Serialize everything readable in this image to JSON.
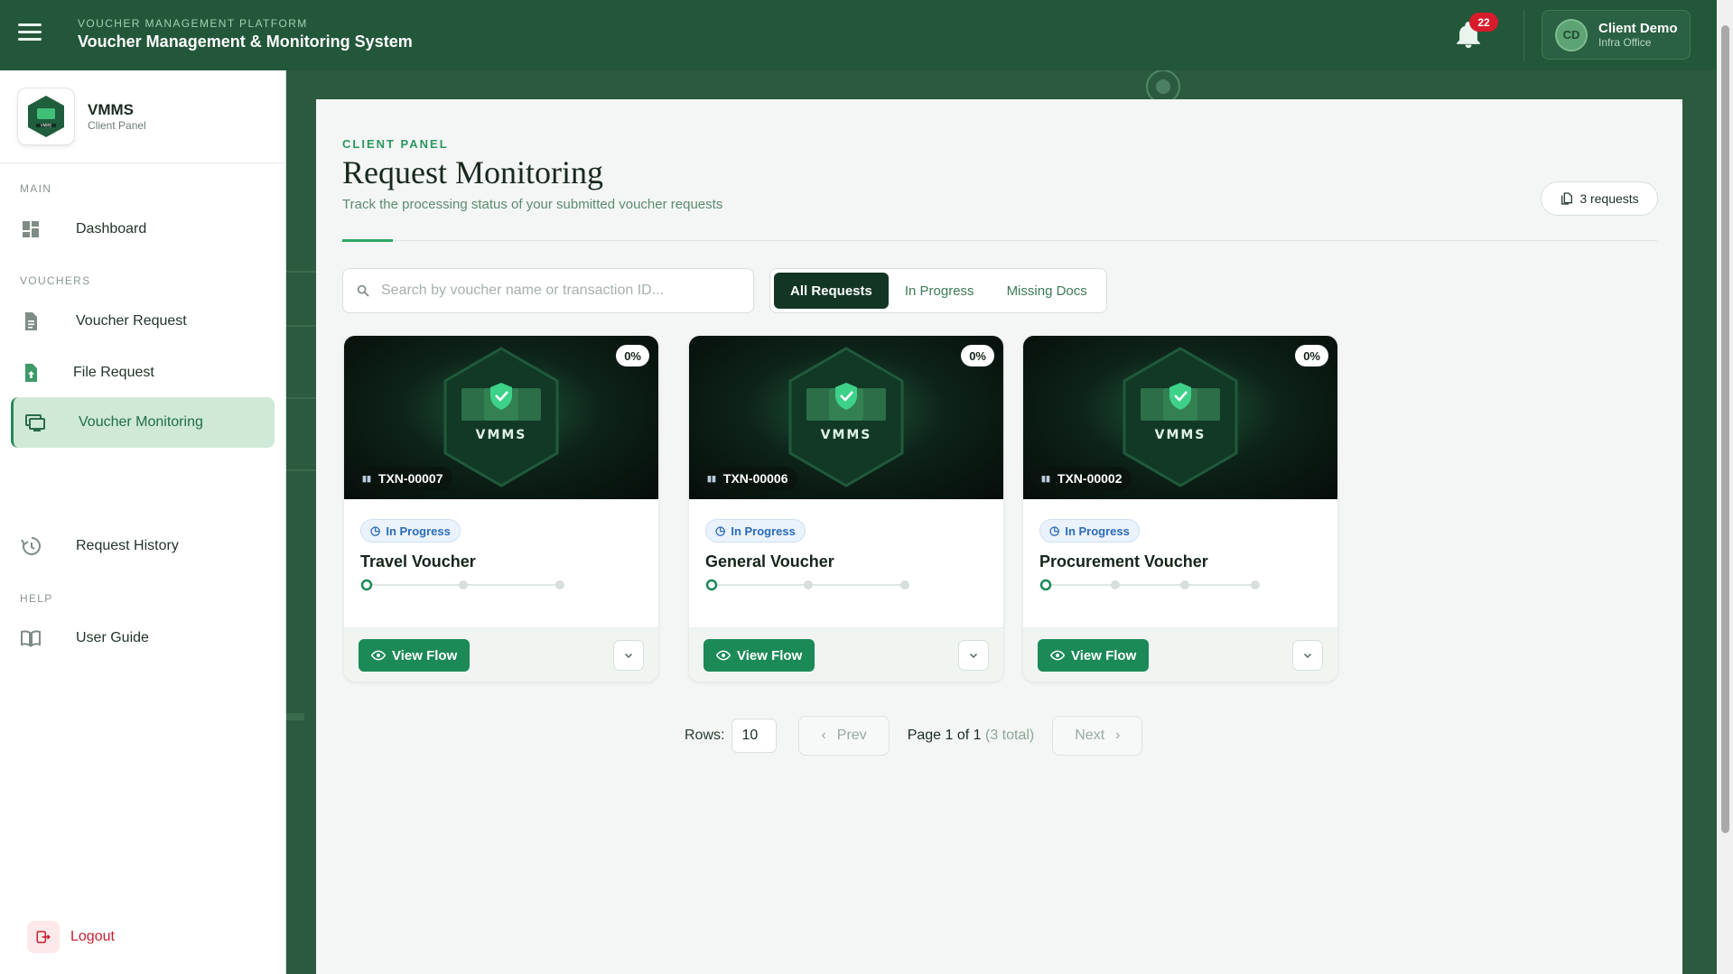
{
  "header": {
    "platform_label": "VOUCHER MANAGEMENT PLATFORM",
    "title": "Voucher Management & Monitoring System",
    "notification_count": "22",
    "user": {
      "initials": "CD",
      "name": "Client Demo",
      "org": "Infra Office"
    }
  },
  "sidebar": {
    "brand_name": "VMMS",
    "brand_sub": "Client Panel",
    "logo_text": "VMMS",
    "sections": {
      "main": "MAIN",
      "vouchers": "VOUCHERS",
      "help": "HELP"
    },
    "items": [
      {
        "label": "Dashboard",
        "icon": "dashboard-icon"
      },
      {
        "label": "Voucher Request",
        "icon": "document-icon"
      },
      {
        "label": "File Request",
        "icon": "file-upload-icon"
      },
      {
        "label": "Voucher Monitoring",
        "icon": "monitor-icon",
        "active": true
      },
      {
        "label": "Request History",
        "icon": "history-icon"
      },
      {
        "label": "User Guide",
        "icon": "book-icon"
      }
    ],
    "logout_label": "Logout"
  },
  "main": {
    "eyebrow": "CLIENT PANEL",
    "title": "Request Monitoring",
    "subtitle": "Track the processing status of your submitted voucher requests",
    "count_chip": "3 requests",
    "search_placeholder": "Search by voucher name or transaction ID...",
    "filters": [
      "All Requests",
      "In Progress",
      "Missing Docs"
    ],
    "cards": [
      {
        "txn": "TXN-00007",
        "percent": "0%",
        "status": "In Progress",
        "name": "Travel Voucher",
        "steps": 3,
        "view_label": "View Flow",
        "hero_text": "VMMS"
      },
      {
        "txn": "TXN-00006",
        "percent": "0%",
        "status": "In Progress",
        "name": "General Voucher",
        "steps": 3,
        "view_label": "View Flow",
        "hero_text": "VMMS"
      },
      {
        "txn": "TXN-00002",
        "percent": "0%",
        "status": "In Progress",
        "name": "Procurement Voucher",
        "steps": 4,
        "view_label": "View Flow",
        "hero_text": "VMMS"
      }
    ],
    "pager": {
      "rows_label": "Rows:",
      "rows_value": "10",
      "prev_label": "Prev",
      "page_info": "Page 1 of 1",
      "total_info": "(3 total)",
      "next_label": "Next"
    }
  },
  "colors": {
    "brand": "#23573a",
    "accent": "#1b8a57",
    "status_blue": "#2b6cb8",
    "logout_red": "#c5202e"
  }
}
